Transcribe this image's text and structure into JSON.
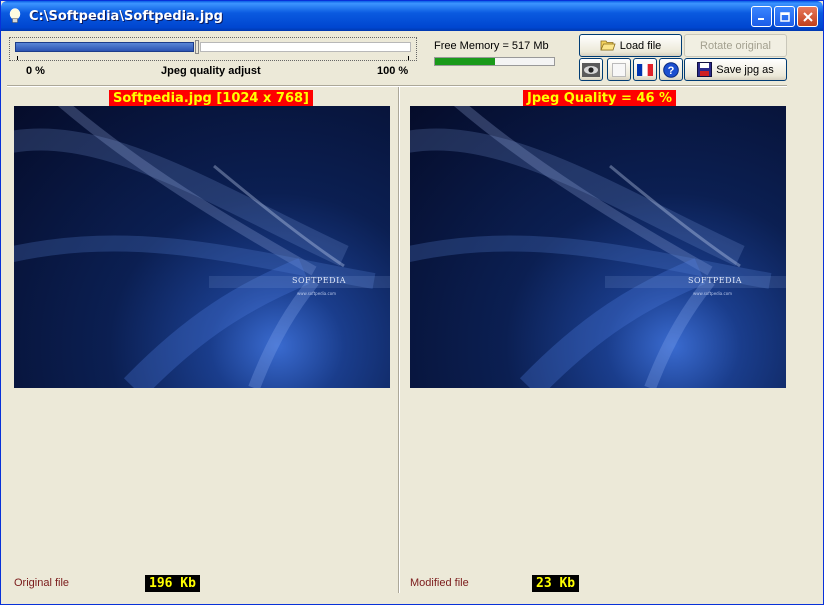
{
  "window": {
    "title": "C:\\Softpedia\\Softpedia.jpg"
  },
  "slider": {
    "label_min": "0 %",
    "label_title": "Jpeg quality adjust",
    "label_max": "100 %",
    "value_percent": 46
  },
  "memory": {
    "label": "Free Memory = 517 Mb",
    "fill_fraction": 0.5
  },
  "buttons": {
    "load": "Load file",
    "rotate": "Rotate original",
    "save": "Save jpg as"
  },
  "left_panel": {
    "caption": "Softpedia.jpg  [1024 x 768]",
    "file_label": "Original file",
    "size": "196 Kb",
    "logo_text": "SOFTPEDIA",
    "logo_sub": "www.softpedia.com"
  },
  "right_panel": {
    "caption": "Jpeg Quality = 46 %",
    "file_label": "Modified file",
    "size": "23 Kb",
    "logo_text": "SOFTPEDIA",
    "logo_sub": "www.softpedia.com"
  },
  "icons": {
    "app": "lightbulb-icon",
    "load": "folder-open-icon",
    "save": "floppy-disk-icon",
    "eye": "eye-icon",
    "blank": "blank-icon",
    "flag": "french-flag-icon",
    "help": "help-icon"
  },
  "colors": {
    "caption_bg": "#ff0000",
    "caption_fg": "#ffff00",
    "badge_bg": "#000000",
    "memory_fill": "#1a9a1a",
    "slider_fill": "#2d55b3"
  }
}
